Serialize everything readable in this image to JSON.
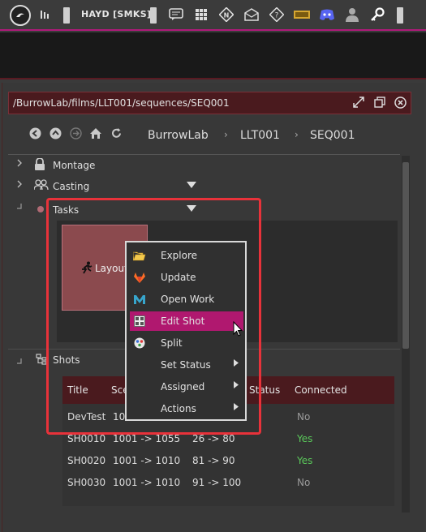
{
  "toolbar": {
    "title": "HAYD [SMKS]",
    "icons": [
      "logo-icon",
      "bars-icon",
      "chat-icon",
      "grid-icon",
      "node-icon",
      "mail-icon",
      "help-icon",
      "ticket-icon",
      "discord-icon",
      "user-icon",
      "key-icon"
    ]
  },
  "pathbar": {
    "path": "/BurrowLab/films/LLT001/sequences/SEQ001"
  },
  "breadcrumb": {
    "items": [
      "BurrowLab",
      "LLT001",
      "SEQ001"
    ],
    "separator": "›"
  },
  "tree": {
    "montage": "Montage",
    "casting": "Casting",
    "tasks": "Tasks",
    "shots": "Shots"
  },
  "task_card": {
    "label": "Layout"
  },
  "context_menu": {
    "items": [
      {
        "label": "Explore",
        "icon": "folder-icon",
        "submenu": false
      },
      {
        "label": "Update",
        "icon": "gitlab-icon",
        "submenu": false
      },
      {
        "label": "Open Work",
        "icon": "maya-icon",
        "submenu": false
      },
      {
        "label": "Edit Shot",
        "icon": "edit-shot-icon",
        "submenu": false,
        "selected": true
      },
      {
        "label": "Split",
        "icon": "split-icon",
        "submenu": false
      },
      {
        "label": "Set Status",
        "icon": "",
        "submenu": true
      },
      {
        "label": "Assigned",
        "icon": "",
        "submenu": true
      },
      {
        "label": "Actions",
        "icon": "",
        "submenu": true
      }
    ]
  },
  "shots_table": {
    "headers": [
      "Title",
      "Sce",
      "Status",
      "Connected"
    ],
    "rows": [
      {
        "title": "DevTest",
        "scene": "100",
        "frames": "",
        "status": "",
        "connected": "No"
      },
      {
        "title": "SH0010",
        "scene": "1001 -> 1055",
        "frames": "26 -> 80",
        "status": "",
        "connected": "Yes"
      },
      {
        "title": "SH0020",
        "scene": "1001 -> 1010",
        "frames": "81 -> 90",
        "status": "",
        "connected": "Yes"
      },
      {
        "title": "SH0030",
        "scene": "1001 -> 1010",
        "frames": "91 -> 100",
        "status": "",
        "connected": "No"
      }
    ]
  },
  "colors": {
    "accent": "#b0186f",
    "highlight": "#e8323a",
    "header_bg": "#4a1a1e",
    "yes": "#5ac85a"
  }
}
